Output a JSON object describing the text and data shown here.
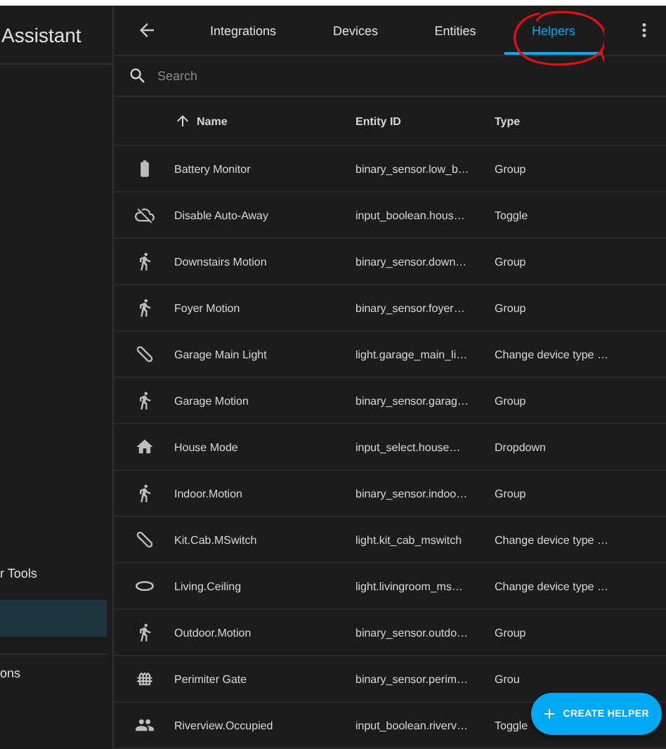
{
  "sidebar": {
    "title": "Assistant",
    "items": [
      {
        "label": "r Tools",
        "selected": false
      },
      {
        "selected": true
      },
      {
        "label": "ons",
        "selected": false
      }
    ]
  },
  "header": {
    "tabs": [
      {
        "label": "Integrations",
        "selected": false
      },
      {
        "label": "Devices",
        "selected": false
      },
      {
        "label": "Entities",
        "selected": false
      },
      {
        "label": "Helpers",
        "selected": true
      }
    ]
  },
  "search": {
    "placeholder": "Search"
  },
  "table": {
    "columns": [
      "Name",
      "Entity ID",
      "Type"
    ],
    "rows": [
      {
        "kind": "battery",
        "name": "Battery Monitor",
        "entity_id": "binary_sensor.low_b…",
        "type": "Group"
      },
      {
        "kind": "cloudoff",
        "name": "Disable Auto-Away",
        "entity_id": "input_boolean.hous…",
        "type": "Toggle"
      },
      {
        "kind": "motion",
        "name": "Downstairs Motion",
        "entity_id": "binary_sensor.down…",
        "type": "Group"
      },
      {
        "kind": "motion",
        "name": "Foyer Motion",
        "entity_id": "binary_sensor.foyer…",
        "type": "Group"
      },
      {
        "kind": "tube",
        "name": "Garage Main Light",
        "entity_id": "light.garage_main_li…",
        "type": "Change device type …"
      },
      {
        "kind": "motion",
        "name": "Garage Motion",
        "entity_id": "binary_sensor.garag…",
        "type": "Group"
      },
      {
        "kind": "home",
        "name": "House Mode",
        "entity_id": "input_select.house…",
        "type": "Dropdown"
      },
      {
        "kind": "motion",
        "name": "Indoor.Motion",
        "entity_id": "binary_sensor.indoo…",
        "type": "Group"
      },
      {
        "kind": "tube",
        "name": "Kit.Cab.MSwitch",
        "entity_id": "light.kit_cab_mswitch",
        "type": "Change device type …"
      },
      {
        "kind": "ceiling",
        "name": "Living.Ceiling",
        "entity_id": "light.livingroom_ms…",
        "type": "Change device type …"
      },
      {
        "kind": "motion",
        "name": "Outdoor.Motion",
        "entity_id": "binary_sensor.outdo…",
        "type": "Group"
      },
      {
        "kind": "fence",
        "name": "Perimiter Gate",
        "entity_id": "binary_sensor.perim…",
        "type": "Grou"
      },
      {
        "kind": "people",
        "name": "Riverview.Occupied",
        "entity_id": "input_boolean.riverv…",
        "type": "Toggle"
      }
    ]
  },
  "fab": {
    "label": "CREATE HELPER"
  }
}
